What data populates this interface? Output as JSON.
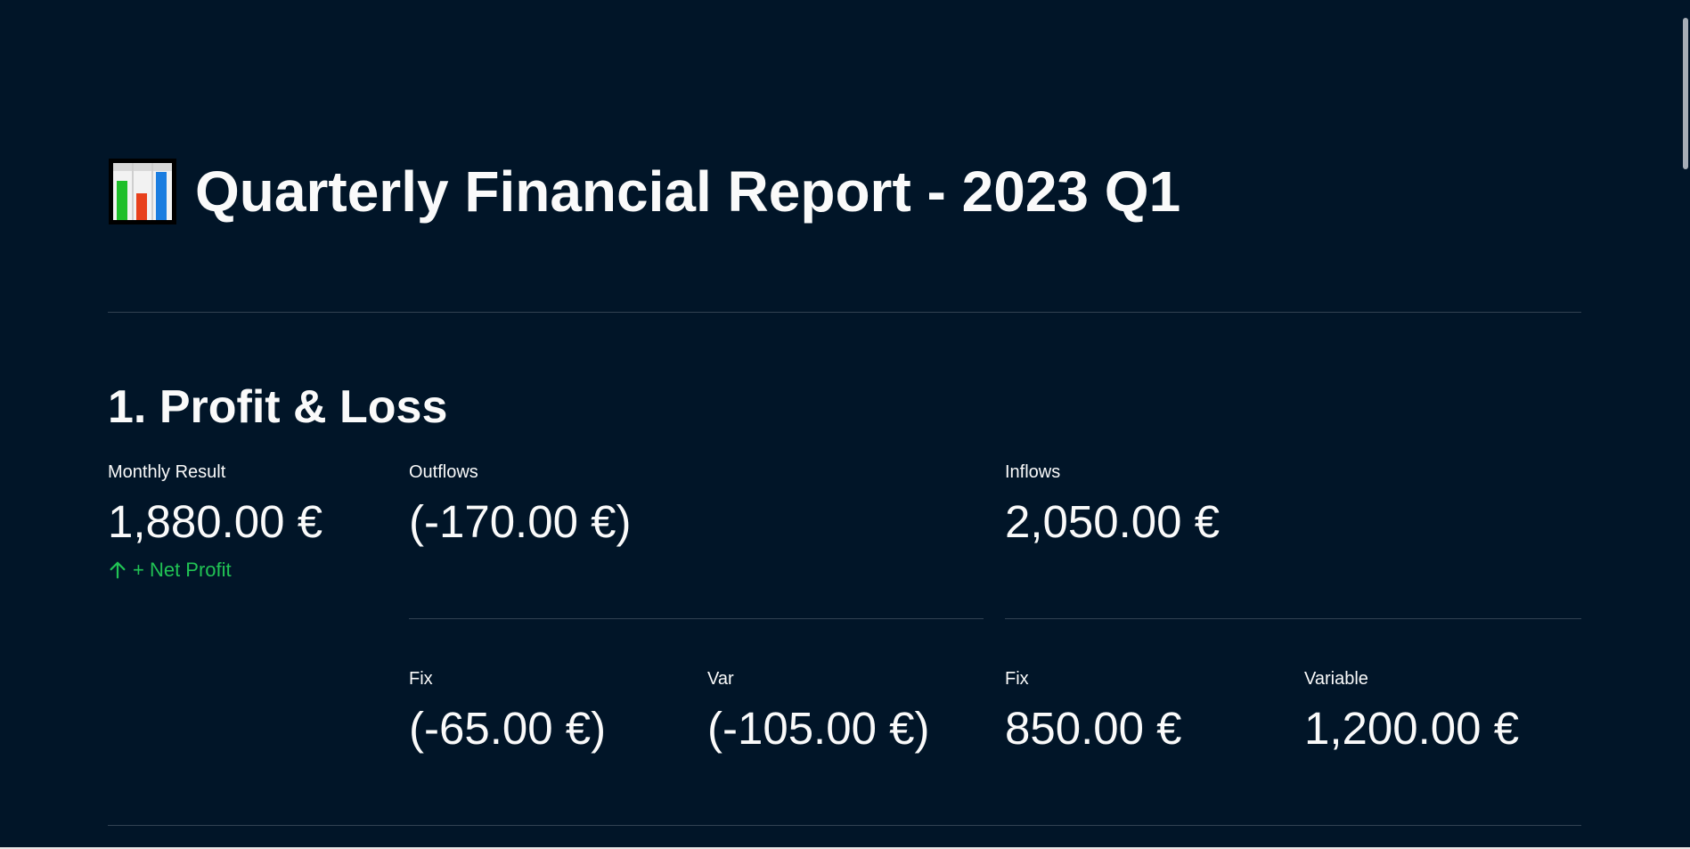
{
  "page": {
    "title": "Quarterly Financial Report - 2023 Q1",
    "title_icon": "bar-chart-icon"
  },
  "section": {
    "title": "1. Profit & Loss"
  },
  "metrics": {
    "monthly_result": {
      "label": "Monthly Result",
      "value": "1,880.00 €",
      "delta": "+ Net Profit",
      "delta_icon": "arrow-up-icon"
    },
    "outflows": {
      "label": "Outflows",
      "value": "(-170.00 €)"
    },
    "inflows": {
      "label": "Inflows",
      "value": "2,050.00 €"
    },
    "outflows_fix": {
      "label": "Fix",
      "value": "(-65.00 €)"
    },
    "outflows_var": {
      "label": "Var",
      "value": "(-105.00 €)"
    },
    "inflows_fix": {
      "label": "Fix",
      "value": "850.00 €"
    },
    "inflows_variable": {
      "label": "Variable",
      "value": "1,200.00 €"
    }
  },
  "colors": {
    "background": "#011528",
    "text": "#fafafa",
    "positive_delta": "#21c354",
    "divider": "rgba(250,250,250,0.2)"
  }
}
